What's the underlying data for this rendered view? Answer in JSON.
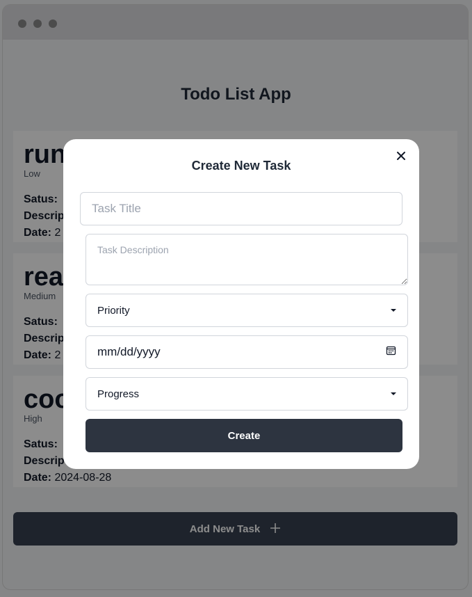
{
  "app": {
    "title": "Todo List App"
  },
  "tasks": [
    {
      "title": "run",
      "priority": "Low",
      "status_label": "Satus:",
      "description_label": "Descrip",
      "date_label": "Date:",
      "date": "2"
    },
    {
      "title": "rea",
      "priority": "Medium",
      "status_label": "Satus:",
      "description_label": "Descrip",
      "date_label": "Date:",
      "date": "2"
    },
    {
      "title": "coo",
      "priority": "High",
      "status_label": "Satus:",
      "description_label": "Descrip",
      "date_label": "Date:",
      "date": "2024-08-28"
    }
  ],
  "add_button": {
    "label": "Add New Task",
    "icon": "plus-icon"
  },
  "modal": {
    "title": "Create New Task",
    "title_placeholder": "Task Title",
    "description_placeholder": "Task Description",
    "priority_label": "Priority",
    "date_placeholder": "mm/dd/yyyy",
    "progress_label": "Progress",
    "create_label": "Create"
  }
}
